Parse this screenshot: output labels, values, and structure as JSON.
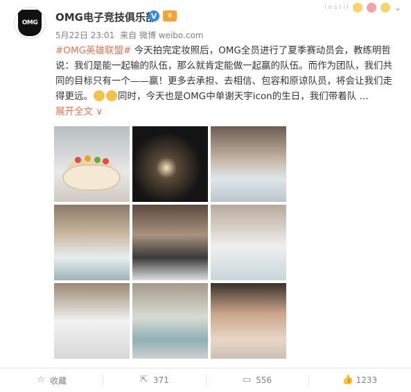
{
  "user": {
    "name": "OMG电子竞技俱乐部",
    "verified_mark": "V",
    "avatar_text": "OMG"
  },
  "post": {
    "date": "5月22日 23:01",
    "source": "来自 微博 weibo.com",
    "topic": "#OMG英雄联盟#",
    "text_1": " 今天拍完定妆照后，OMG全员进行了夏季赛动员会，教练明哲说：我们是能一起输的队伍，那么就肯定能做一起赢的队伍。而作为团队，我们共同的目标只有一个——赢！更多去承担、去相信、包容和原谅队员，将会让我们走得更远。",
    "text_2": "同时，今天也是OMG中单谢天宇icon的生日，我们带着队 ...",
    "expand_label": "展开全文",
    "expand_arrow": "∨",
    "photo_names": [
      "photo-cake",
      "photo-candles",
      "photo-table-wide",
      "photo-players-table",
      "photo-player-black-shirt",
      "photo-player-drink",
      "photo-player-chin-rest",
      "photo-table-flowers",
      "photo-player-ear"
    ]
  },
  "header_right": {
    "level_text": "i n s l i l",
    "chevron": "⌄"
  },
  "actions": [
    {
      "icon": "star-icon",
      "glyph": "☆",
      "label": "收藏"
    },
    {
      "icon": "share-icon",
      "glyph": "⇱",
      "label": "371"
    },
    {
      "icon": "comment-icon",
      "glyph": "▭",
      "label": "556"
    },
    {
      "icon": "like-icon",
      "glyph": "👍",
      "label": "1233"
    }
  ]
}
